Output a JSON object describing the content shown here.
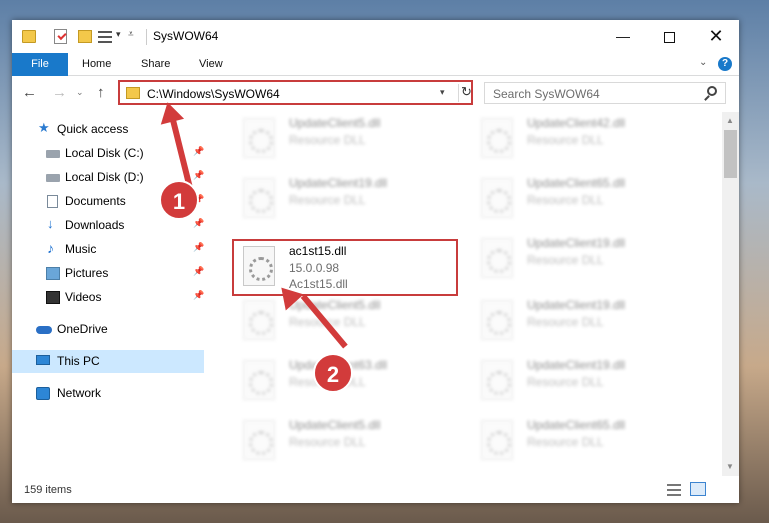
{
  "window": {
    "title": "SysWOW64",
    "controls": {
      "minimize": "—",
      "maximize": "",
      "close": "✕"
    }
  },
  "ribbon": {
    "tabs": [
      "File",
      "Home",
      "Share",
      "View"
    ],
    "help": "?"
  },
  "address_bar": {
    "path": "C:\\Windows\\SysWOW64",
    "search_placeholder": "Search SysWOW64"
  },
  "nav_pane": {
    "items": [
      {
        "label": "Quick access",
        "icon": "star-icon"
      },
      {
        "label": "Local Disk (C:)",
        "icon": "drive-icon",
        "pinned": true
      },
      {
        "label": "Local Disk (D:)",
        "icon": "drive-icon",
        "pinned": true
      },
      {
        "label": "Documents",
        "icon": "documents-icon",
        "pinned": true
      },
      {
        "label": "Downloads",
        "icon": "downloads-icon",
        "pinned": true
      },
      {
        "label": "Music",
        "icon": "music-icon",
        "pinned": true
      },
      {
        "label": "Pictures",
        "icon": "pictures-icon",
        "pinned": true
      },
      {
        "label": "Videos",
        "icon": "videos-icon",
        "pinned": true
      },
      {
        "label": "OneDrive",
        "icon": "onedrive-icon"
      },
      {
        "label": "This PC",
        "icon": "pc-icon",
        "selected": true
      },
      {
        "label": "Network",
        "icon": "network-icon"
      }
    ]
  },
  "files": {
    "highlighted": {
      "name": "ac1st15.dll",
      "version": "15.0.0.98",
      "description": "Ac1st15.dll"
    },
    "blurred": [
      {
        "name": "UpdateClient5.dll",
        "type": "Resource DLL"
      },
      {
        "name": "UpdateClient42.dll",
        "type": "Resource DLL"
      },
      {
        "name": "UpdateClient19.dll",
        "type": "Resource DLL"
      },
      {
        "name": "UpdateClient65.dll",
        "type": "Resource DLL"
      },
      {
        "name": "UpdateClient19.dll",
        "type": "Resource DLL"
      },
      {
        "name": "UpdateClient5.dll",
        "type": "Resource DLL"
      },
      {
        "name": "UpdateClient19.dll",
        "type": "Resource DLL"
      },
      {
        "name": "UpdateClient63.dll",
        "type": "Resource DLL"
      },
      {
        "name": "UpdateClient19.dll",
        "type": "Resource DLL"
      },
      {
        "name": "UpdateClient5.dll",
        "type": "Resource DLL"
      },
      {
        "name": "UpdateClient65.dll",
        "type": "Resource DLL"
      }
    ]
  },
  "status_bar": {
    "item_count": "159 items"
  },
  "annotations": {
    "step1": "1",
    "step2": "2",
    "color": "#d23b3b"
  }
}
